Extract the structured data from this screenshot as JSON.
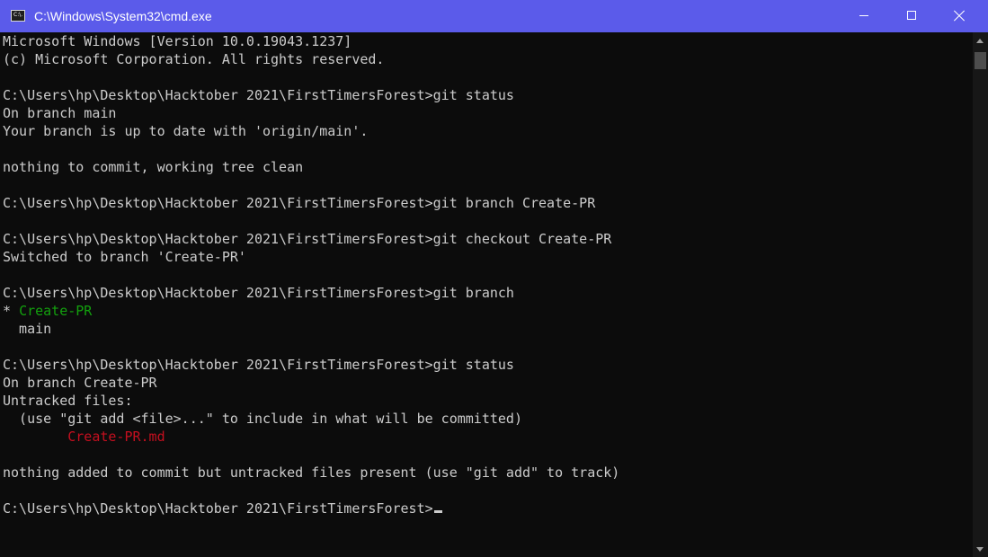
{
  "window": {
    "title": "C:\\Windows\\System32\\cmd.exe",
    "icon": "cmd-icon",
    "icon_text": "C:\\."
  },
  "colors": {
    "titlebar": "#5b5bea",
    "background": "#0c0c0c",
    "text": "#cccccc",
    "green": "#13a10e",
    "red": "#c50f1f"
  },
  "console": {
    "lines": [
      "Microsoft Windows [Version 10.0.19043.1237]",
      "(c) Microsoft Corporation. All rights reserved.",
      "",
      "C:\\Users\\hp\\Desktop\\Hacktober 2021\\FirstTimersForest>git status",
      "On branch main",
      "Your branch is up to date with 'origin/main'.",
      "",
      "nothing to commit, working tree clean",
      "",
      "C:\\Users\\hp\\Desktop\\Hacktober 2021\\FirstTimersForest>git branch Create-PR",
      "",
      "C:\\Users\\hp\\Desktop\\Hacktober 2021\\FirstTimersForest>git checkout Create-PR",
      "Switched to branch 'Create-PR'",
      "",
      "C:\\Users\\hp\\Desktop\\Hacktober 2021\\FirstTimersForest>git branch",
      "* Create-PR",
      "  main",
      "",
      "C:\\Users\\hp\\Desktop\\Hacktober 2021\\FirstTimersForest>git status",
      "On branch Create-PR",
      "Untracked files:",
      "  (use \"git add <file>...\" to include in what will be committed)",
      "        Create-PR.md",
      "",
      "nothing added to commit but untracked files present (use \"git add\" to track)",
      "",
      "C:\\Users\\hp\\Desktop\\Hacktober 2021\\FirstTimersForest>"
    ],
    "line_colors": {
      "15": "green",
      "22": "red"
    }
  }
}
